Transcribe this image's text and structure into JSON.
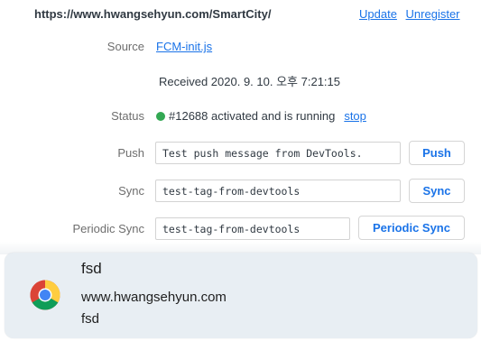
{
  "service_worker": {
    "scope_url": "https://www.hwangsehyun.com/SmartCity/",
    "update_link": "Update",
    "unregister_link": "Unregister",
    "source": {
      "label": "Source",
      "file_link": "FCM-init.js",
      "received": "Received 2020. 9. 10. 오후 7:21:15"
    },
    "status": {
      "label": "Status",
      "text": "#12688 activated and is running",
      "stop_link": "stop",
      "dot_color": "#33a853"
    },
    "push": {
      "label": "Push",
      "input_value": "Test push message from DevTools.",
      "button": "Push"
    },
    "sync": {
      "label": "Sync",
      "input_value": "test-tag-from-devtools",
      "button": "Sync"
    },
    "periodic_sync": {
      "label": "Periodic Sync",
      "input_value": "test-tag-from-devtools",
      "button": "Periodic Sync"
    }
  },
  "notification": {
    "icon": "chrome-icon",
    "title": "fsd",
    "origin": "www.hwangsehyun.com",
    "body": "fsd"
  },
  "colors": {
    "link": "#1a73e8",
    "notification_bg": "#e8eef3"
  }
}
